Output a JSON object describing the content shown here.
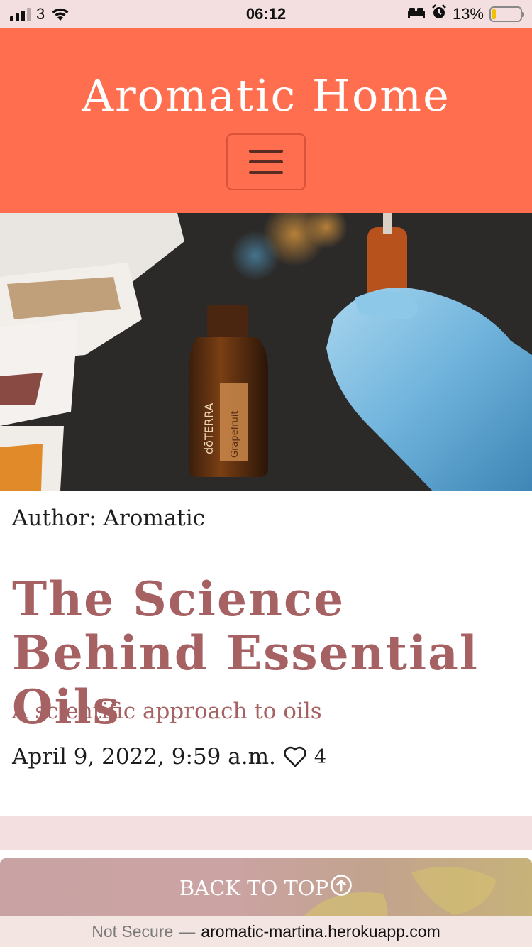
{
  "status_bar": {
    "carrier": "3",
    "time": "06:12",
    "battery": "13%",
    "battery_level": 0.13
  },
  "header": {
    "brand": "Aromatic Home"
  },
  "post": {
    "author": "Author: Aromatic",
    "title": "The Science Behind Essential Oils",
    "subtitle": "A scientific approach to oils",
    "date": "April 9, 2022, 9:59 a.m.",
    "likes": "4"
  },
  "footer": {
    "back_to_top": "BACK TO TOP"
  },
  "browser": {
    "security": "Not Secure",
    "separator": "—",
    "host": "aromatic-martina.herokuapp.com"
  },
  "colors": {
    "header_bg": "#ff6e4f",
    "accent_title": "#a66163",
    "band_pink": "#f4dfe0"
  }
}
